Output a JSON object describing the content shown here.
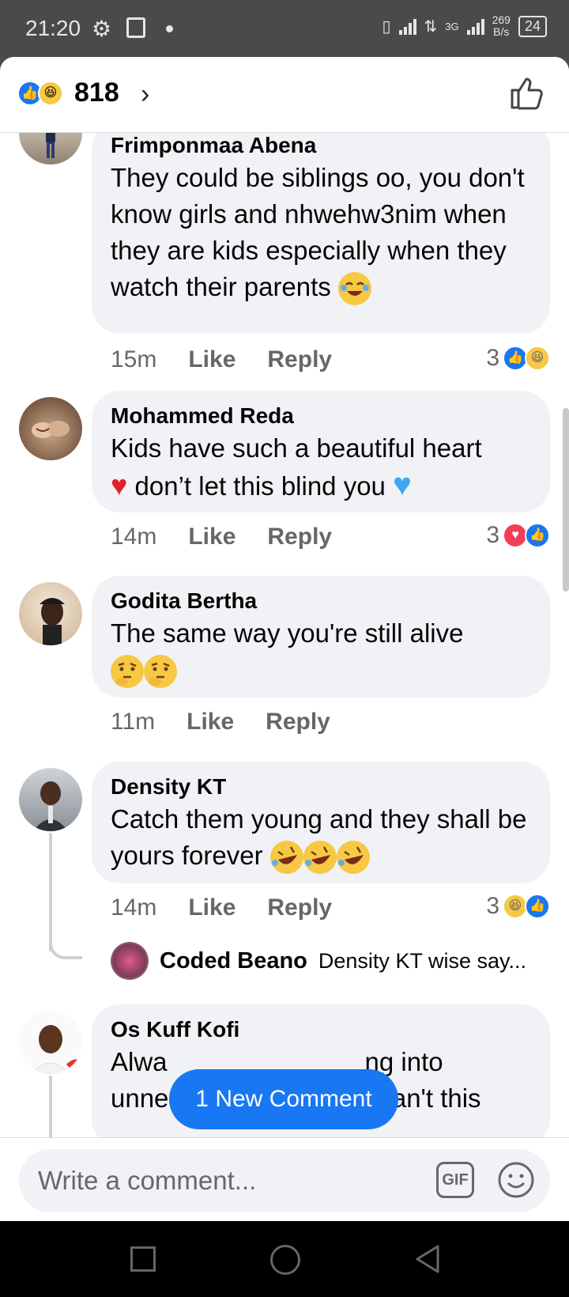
{
  "status": {
    "time": "21:20",
    "speed_value": "269",
    "speed_unit": "B/s",
    "battery": "24",
    "net": "3G"
  },
  "header": {
    "reaction_count": "818"
  },
  "comments": [
    {
      "author": "Frimponmaa Abena",
      "text": "They could be siblings oo, you don't know girls and nhwehw3nim when they are kids especially when they watch their parents",
      "time": "15m",
      "like": "Like",
      "reply": "Reply",
      "reactions": "3"
    },
    {
      "author": "Mohammed Reda",
      "text_a": "Kids have such a beautiful heart",
      "text_b": "don’t let this blind you",
      "time": "14m",
      "like": "Like",
      "reply": "Reply",
      "reactions": "3"
    },
    {
      "author": "Godita Bertha",
      "text": "The same way you're still alive",
      "time": "11m",
      "like": "Like",
      "reply": "Reply"
    },
    {
      "author": "Density KT",
      "text": "Catch them young and they shall be yours forever",
      "time": "14m",
      "like": "Like",
      "reply": "Reply",
      "reactions": "3"
    },
    {
      "author": "Os Kuff Kofi",
      "text_a": "Alwa",
      "text_a2": "ng into",
      "text_b": "unnecessary things,,,,, can't this"
    }
  ],
  "reply_preview": {
    "name": "Coded Beano",
    "text": "Density KT wise say..."
  },
  "new_comment_label": "1 New Comment",
  "composer": {
    "placeholder": "Write a comment...",
    "gif_label": "GIF"
  },
  "colors": {
    "accent": "#1877f2",
    "bubble": "#f0f2f5",
    "meta": "#65676b"
  }
}
